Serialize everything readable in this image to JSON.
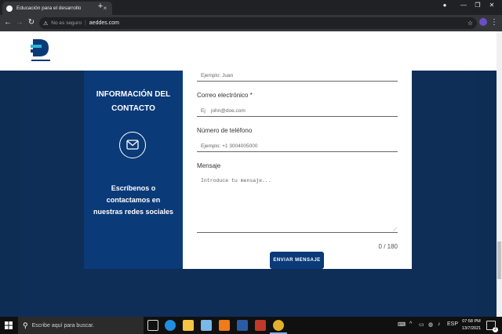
{
  "browser": {
    "tab_title": "Educación para el desarrollo",
    "tab_close": "×",
    "new_tab": "+",
    "security_label": "No es seguro",
    "url": "aeddes.com",
    "window_minimize": "—",
    "window_restore": "❐",
    "window_close": "✕"
  },
  "contact_panel": {
    "title": "INFORMACIÓN DEL CONTACTO",
    "message": "Escríbenos o contactamos en nuestras redes sociales"
  },
  "form": {
    "name_placeholder": "Ejemplo: Juan",
    "email_label": "Correo electrónico *",
    "email_placeholder": "Ej    john@doe.com",
    "phone_label": "Número de teléfono",
    "phone_placeholder": "Ejemplo: +1 3004005000",
    "message_label": "Mensaje",
    "message_placeholder": "Introduce tu mensaje...",
    "counter": "0 / 180",
    "submit_label": "ENVIAR MENSAJE"
  },
  "taskbar": {
    "search_placeholder": "Escribe aquí para buscar.",
    "language": "ESP",
    "time": "07:58 PM",
    "date": "13/7/2021",
    "notification_count": "2"
  },
  "colors": {
    "page_bg": "#0d2d55",
    "panel_blue": "#0b3a78",
    "button_blue": "#0b3a78"
  }
}
